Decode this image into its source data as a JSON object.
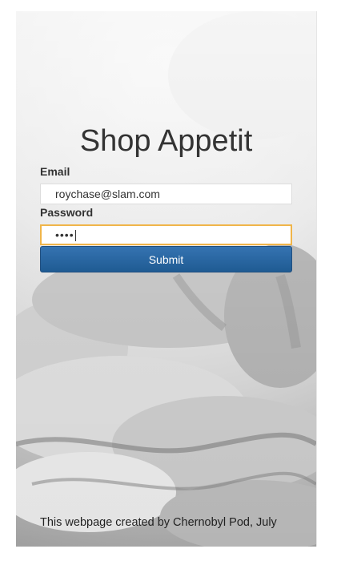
{
  "app": {
    "title": "Shop Appetit"
  },
  "form": {
    "email_label": "Email",
    "email_value": "roychase@slam.com",
    "password_label": "Password",
    "password_value": "••••",
    "submit_label": "Submit"
  },
  "footer": {
    "text": "This webpage created by Chernobyl Pod, July"
  }
}
